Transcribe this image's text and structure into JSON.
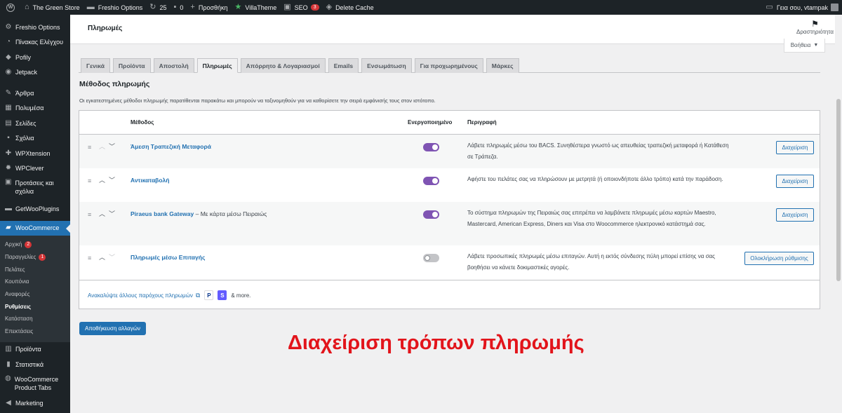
{
  "adminbar": {
    "site_name": "The Green Store",
    "freshio_options": "Freshio Options",
    "updates_count": "25",
    "comments_count": "0",
    "new_label": "Προσθήκη",
    "villatheme": "VillaTheme",
    "seo": "SEO",
    "seo_badge": "3",
    "delete_cache": "Delete Cache",
    "greeting": "Γεια σου, vtampak"
  },
  "sidebar": {
    "top_items": [
      {
        "label": "Freshio Options",
        "icon": "gear-icon"
      },
      {
        "label": "Πίνακας Ελέγχου",
        "icon": "dashboard-icon"
      },
      {
        "label": "Pofily",
        "icon": "pofily-icon"
      },
      {
        "label": "Jetpack",
        "icon": "jetpack-icon"
      }
    ],
    "content_items": [
      {
        "label": "Άρθρα",
        "icon": "pin-icon"
      },
      {
        "label": "Πολυμέσα",
        "icon": "media-icon"
      },
      {
        "label": "Σελίδες",
        "icon": "pages-icon"
      },
      {
        "label": "Σχόλια",
        "icon": "comments-icon"
      },
      {
        "label": "WPXtension",
        "icon": "plugin-icon"
      },
      {
        "label": "WPClever",
        "icon": "plugin-icon"
      },
      {
        "label": "Προτάσεις και σχόλια",
        "icon": "feedback-icon"
      }
    ],
    "getwoo": "GetWooPlugins",
    "woocommerce": "WooCommerce",
    "submenu": [
      {
        "label": "Αρχική",
        "badge": "2"
      },
      {
        "label": "Παραγγελίες",
        "badge": "1"
      },
      {
        "label": "Πελάτες",
        "badge": ""
      },
      {
        "label": "Κουπόνια",
        "badge": ""
      },
      {
        "label": "Αναφορές",
        "badge": ""
      },
      {
        "label": "Ρυθμίσεις",
        "badge": ""
      },
      {
        "label": "Κατάσταση",
        "badge": ""
      },
      {
        "label": "Επεκτάσεις",
        "badge": ""
      }
    ],
    "bottom_items": [
      {
        "label": "Προϊόντα",
        "icon": "products-icon"
      },
      {
        "label": "Στατιστικά",
        "icon": "stats-icon"
      },
      {
        "label": "WooCommerce Product Tabs",
        "icon": "tabs-icon"
      },
      {
        "label": "Marketing",
        "icon": "megaphone-icon"
      }
    ]
  },
  "header": {
    "title": "Πληρωμές",
    "activity": "Δραστηριότητα",
    "help": "Βοήθεια"
  },
  "tabs": [
    "Γενικά",
    "Προϊόντα",
    "Αποστολή",
    "Πληρωμές",
    "Απόρρητο & Λογαριασμοί",
    "Emails",
    "Ενσωμάτωση",
    "Για προχωρημένους",
    "Μάρκες"
  ],
  "active_tab": "Πληρωμές",
  "section": {
    "heading": "Μέθοδος πληρωμής",
    "description": "Οι εγκατεστημένες μέθοδοι πληρωμής παρατίθενται παρακάτω και μπορούν να ταξινομηθούν για να καθορίσετε την σειρά εμφάνισής τους στον ιστότοπο."
  },
  "table": {
    "columns": {
      "method": "Μέθοδος",
      "enabled": "Ενεργοποιημένο",
      "description": "Περιγραφή"
    },
    "rows": [
      {
        "title": "Άμεση Τραπεζική Μεταφορά",
        "subtitle": "",
        "enabled": true,
        "description": "Λάβετε πληρωμές μέσω του BACS. Συνηθέστερα γνωστό ως απευθείας τραπεζική μεταφορά ή Κατάθεση σε Τράπεζα.",
        "action": "Διαχείριση"
      },
      {
        "title": "Αντικαταβολή",
        "subtitle": "",
        "enabled": true,
        "description": "Αφήστε του πελάτες σας να πληρώσουν με μετρητά (ή οποιονδήποτε άλλο τρόπο) κατά την παράδοση.",
        "action": "Διαχείριση"
      },
      {
        "title": "Piraeus bank Gateway",
        "subtitle": " – Με κάρτα μέσω Πειραιώς",
        "enabled": true,
        "description": "Το σύστημα πληρωμών της Πειραιώς σας επιτρέπει να λαμβάνετε πληρωμές μέσω καρτών Maestro, Mastercard, American Express, Diners και Visa στο Woocommerce ηλεκτρονικό κατάστημά σας.",
        "action": "Διαχείριση"
      },
      {
        "title": "Πληρωμές μέσω Επιταγής",
        "subtitle": "",
        "enabled": false,
        "description": "Λάβετε προσωπικές πληρωμές μέσω επιταγών. Αυτή η εκτός σύνδεσης πύλη μπορεί επίσης να σας βοηθήσει να κάνετε δοκιμαστικές αγορές.",
        "action": "Ολοκλήρωση ρύθμισης"
      }
    ],
    "discover_link": "Ανακαλύψτε άλλους παρόχους πληρωμών",
    "paypal_logo": "P",
    "stripe_logo": "S",
    "more_text": "& more."
  },
  "save_button": "Αποθήκευση αλλαγών",
  "caption": "Διαχείριση τρόπων πληρωμής",
  "colors": {
    "accent": "#2271b1",
    "toggle_on": "#7f54b3",
    "caption": "#e2141b",
    "admin_dark": "#1d2327"
  }
}
